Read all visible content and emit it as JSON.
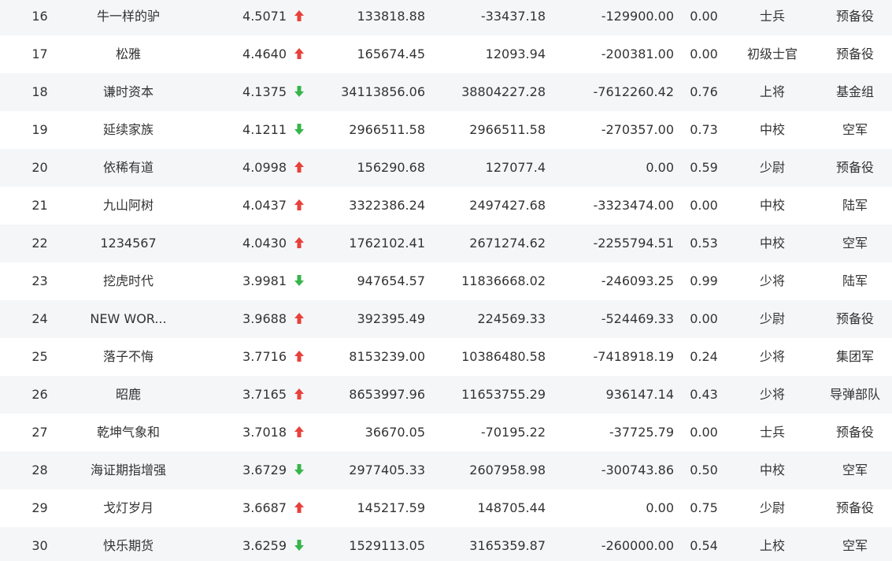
{
  "colors": {
    "up": "#e8413b",
    "down": "#36b54a",
    "even_row_bg": "#f5f6f8",
    "text": "#333333"
  },
  "rows": [
    {
      "rank": "16",
      "name": "牛一样的驴",
      "score": "4.5071",
      "trend": "up",
      "trend_icon": "arrow-up-icon",
      "v1": "133818.88",
      "v2": "-33437.18",
      "v3": "-129900.00",
      "ratio": "0.00",
      "level": "士兵",
      "group": "预备役"
    },
    {
      "rank": "17",
      "name": "松雅",
      "score": "4.4640",
      "trend": "up",
      "trend_icon": "arrow-up-icon",
      "v1": "165674.45",
      "v2": "12093.94",
      "v3": "-200381.00",
      "ratio": "0.00",
      "level": "初级士官",
      "group": "预备役"
    },
    {
      "rank": "18",
      "name": "谦时资本",
      "score": "4.1375",
      "trend": "down",
      "trend_icon": "arrow-down-icon",
      "v1": "34113856.06",
      "v2": "38804227.28",
      "v3": "-7612260.42",
      "ratio": "0.76",
      "level": "上将",
      "group": "基金组"
    },
    {
      "rank": "19",
      "name": "延续家族",
      "score": "4.1211",
      "trend": "down",
      "trend_icon": "arrow-down-icon",
      "v1": "2966511.58",
      "v2": "2966511.58",
      "v3": "-270357.00",
      "ratio": "0.73",
      "level": "中校",
      "group": "空军"
    },
    {
      "rank": "20",
      "name": "依稀有道",
      "score": "4.0998",
      "trend": "up",
      "trend_icon": "arrow-up-icon",
      "v1": "156290.68",
      "v2": "127077.4",
      "v3": "0.00",
      "ratio": "0.59",
      "level": "少尉",
      "group": "预备役"
    },
    {
      "rank": "21",
      "name": "九山阿树",
      "score": "4.0437",
      "trend": "up",
      "trend_icon": "arrow-up-icon",
      "v1": "3322386.24",
      "v2": "2497427.68",
      "v3": "-3323474.00",
      "ratio": "0.00",
      "level": "中校",
      "group": "陆军"
    },
    {
      "rank": "22",
      "name": "1234567",
      "score": "4.0430",
      "trend": "up",
      "trend_icon": "arrow-up-icon",
      "v1": "1762102.41",
      "v2": "2671274.62",
      "v3": "-2255794.51",
      "ratio": "0.53",
      "level": "中校",
      "group": "空军"
    },
    {
      "rank": "23",
      "name": "挖虎时代",
      "score": "3.9981",
      "trend": "down",
      "trend_icon": "arrow-down-icon",
      "v1": "947654.57",
      "v2": "11836668.02",
      "v3": "-246093.25",
      "ratio": "0.99",
      "level": "少将",
      "group": "陆军"
    },
    {
      "rank": "24",
      "name": "NEW WOR...",
      "score": "3.9688",
      "trend": "up",
      "trend_icon": "arrow-up-icon",
      "v1": "392395.49",
      "v2": "224569.33",
      "v3": "-524469.33",
      "ratio": "0.00",
      "level": "少尉",
      "group": "预备役"
    },
    {
      "rank": "25",
      "name": "落子不悔",
      "score": "3.7716",
      "trend": "up",
      "trend_icon": "arrow-up-icon",
      "v1": "8153239.00",
      "v2": "10386480.58",
      "v3": "-7418918.19",
      "ratio": "0.24",
      "level": "少将",
      "group": "集团军"
    },
    {
      "rank": "26",
      "name": "昭鹿",
      "score": "3.7165",
      "trend": "up",
      "trend_icon": "arrow-up-icon",
      "v1": "8653997.96",
      "v2": "11653755.29",
      "v3": "936147.14",
      "ratio": "0.43",
      "level": "少将",
      "group": "导弹部队"
    },
    {
      "rank": "27",
      "name": "乾坤气象和",
      "score": "3.7018",
      "trend": "up",
      "trend_icon": "arrow-up-icon",
      "v1": "36670.05",
      "v2": "-70195.22",
      "v3": "-37725.79",
      "ratio": "0.00",
      "level": "士兵",
      "group": "预备役"
    },
    {
      "rank": "28",
      "name": "海证期指增强",
      "score": "3.6729",
      "trend": "down",
      "trend_icon": "arrow-down-icon",
      "v1": "2977405.33",
      "v2": "2607958.98",
      "v3": "-300743.86",
      "ratio": "0.50",
      "level": "中校",
      "group": "空军"
    },
    {
      "rank": "29",
      "name": "戈灯岁月",
      "score": "3.6687",
      "trend": "up",
      "trend_icon": "arrow-up-icon",
      "v1": "145217.59",
      "v2": "148705.44",
      "v3": "0.00",
      "ratio": "0.75",
      "level": "少尉",
      "group": "预备役"
    },
    {
      "rank": "30",
      "name": "快乐期货",
      "score": "3.6259",
      "trend": "down",
      "trend_icon": "arrow-down-icon",
      "v1": "1529113.05",
      "v2": "3165359.87",
      "v3": "-260000.00",
      "ratio": "0.54",
      "level": "上校",
      "group": "空军"
    }
  ]
}
